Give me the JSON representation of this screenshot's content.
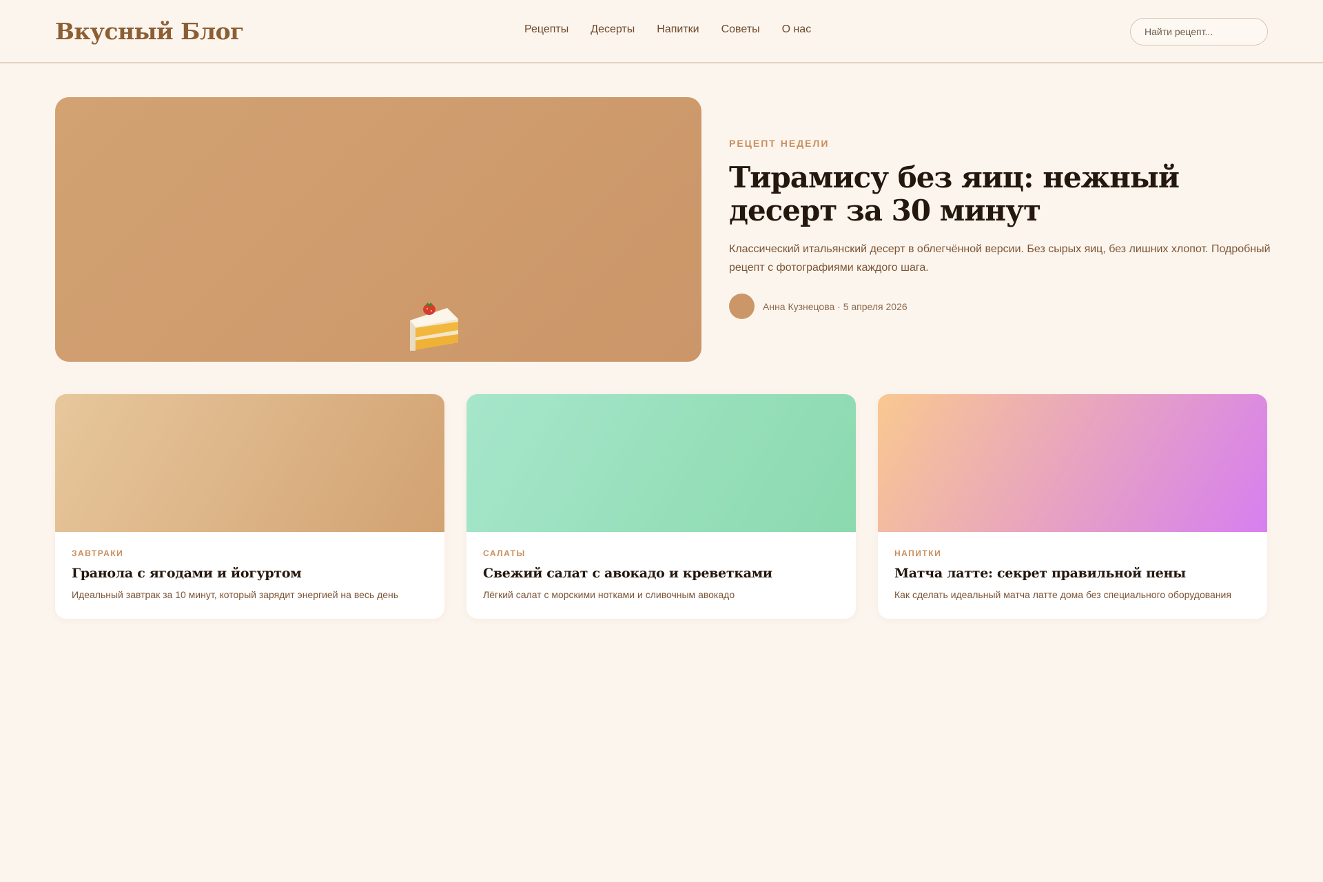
{
  "header": {
    "logo": "Вкусный Блог",
    "nav": [
      "Рецепты",
      "Десерты",
      "Напитки",
      "Советы",
      "О нас"
    ],
    "search_placeholder": "Найти рецепт..."
  },
  "hero": {
    "image_icon": "cake-slice-icon",
    "kicker": "РЕЦЕПТ НЕДЕЛИ",
    "title": "Тирамису без яиц: нежный десерт за 30 минут",
    "description": "Классический итальянский десерт в облегчённой версии. Без сырых яиц, без лишних хлопот. Подробный рецепт с фотографиями каждого шага.",
    "author_meta": "Анна Кузнецова · 5 апреля 2026"
  },
  "cards": [
    {
      "category": "ЗАВТРАКИ",
      "title": "Гранола с ягодами и йогуртом",
      "description": "Идеальный завтрак за 10 минут, который зарядит энергией на весь день",
      "gradient": [
        "#e7c79c",
        "#d2a272"
      ]
    },
    {
      "category": "САЛАТЫ",
      "title": "Свежий салат с авокадо и креветками",
      "description": "Лёгкий салат с морскими нотками и сливочным авокадо",
      "gradient": [
        "#a6e6cb",
        "#8bd9ae"
      ]
    },
    {
      "category": "НАПИТКИ",
      "title": "Матча латте: секрет правильной пены",
      "description": "Как сделать идеальный матча латте дома без специального оборудования",
      "gradient": [
        "#f9c890",
        "#d67ff0"
      ]
    }
  ],
  "colors": {
    "background": "#fcf5ee",
    "accent": "#c98e5d",
    "logo": "#8c5e33",
    "heading": "#24170d"
  }
}
